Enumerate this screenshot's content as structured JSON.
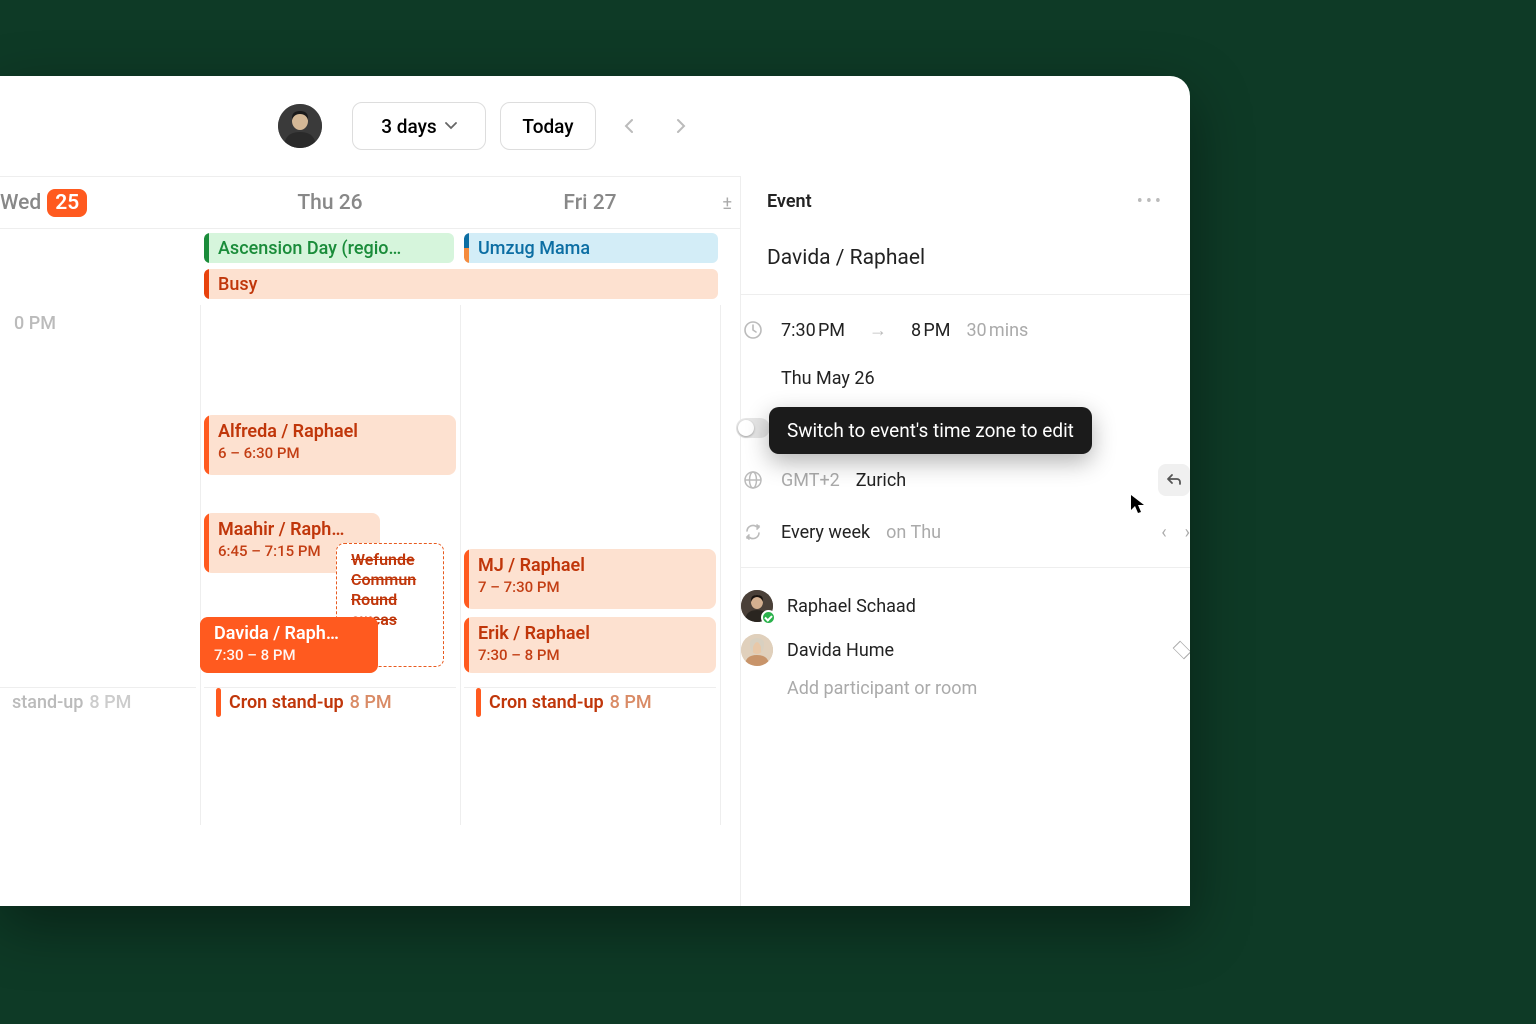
{
  "toolbar": {
    "range_label": "3 days",
    "today_label": "Today"
  },
  "days": {
    "wed": {
      "label": "Wed",
      "num": "25"
    },
    "thu": {
      "label": "Thu 26"
    },
    "fri": {
      "label": "Fri 27"
    }
  },
  "allday": {
    "ascension": "Ascension Day (regio…",
    "umzug": "Umzug Mama",
    "busy": "Busy"
  },
  "events": {
    "ghost_time": "0 PM",
    "alfreda": {
      "title": "Alfreda / Raphael",
      "time": "6 – 6:30 PM"
    },
    "maahir": {
      "title": "Maahir / Raph…",
      "time": "6:45 – 7:15 PM"
    },
    "cancelled": "Wefunde Commun Round owcas",
    "davida": {
      "title": "Davida / Raph…",
      "time": "7:30 – 8 PM"
    },
    "mj": {
      "title": "MJ / Raphael",
      "time": "7 – 7:30 PM"
    },
    "erik": {
      "title": "Erik / Raphael",
      "time": "7:30 – 8 PM"
    },
    "standup": {
      "label": "Cron stand-up",
      "time": "8 PM"
    },
    "standup_ghost": {
      "label": "stand-up",
      "time": "8 PM"
    }
  },
  "panel": {
    "heading": "Event",
    "title": "Davida / Raphael",
    "start": "7:30 PM",
    "end": "8 PM",
    "duration": "30 mins",
    "date": "Thu May 26",
    "tooltip": "Switch to event's time zone to edit",
    "tz_offset": "GMT+2",
    "tz_city": "Zurich",
    "repeat": "Every week",
    "repeat_on": "on Thu",
    "participants": [
      {
        "name": "Raphael Schaad",
        "accepted": true
      },
      {
        "name": "Davida Hume",
        "accepted": false
      }
    ],
    "add_placeholder": "Add participant or room"
  }
}
